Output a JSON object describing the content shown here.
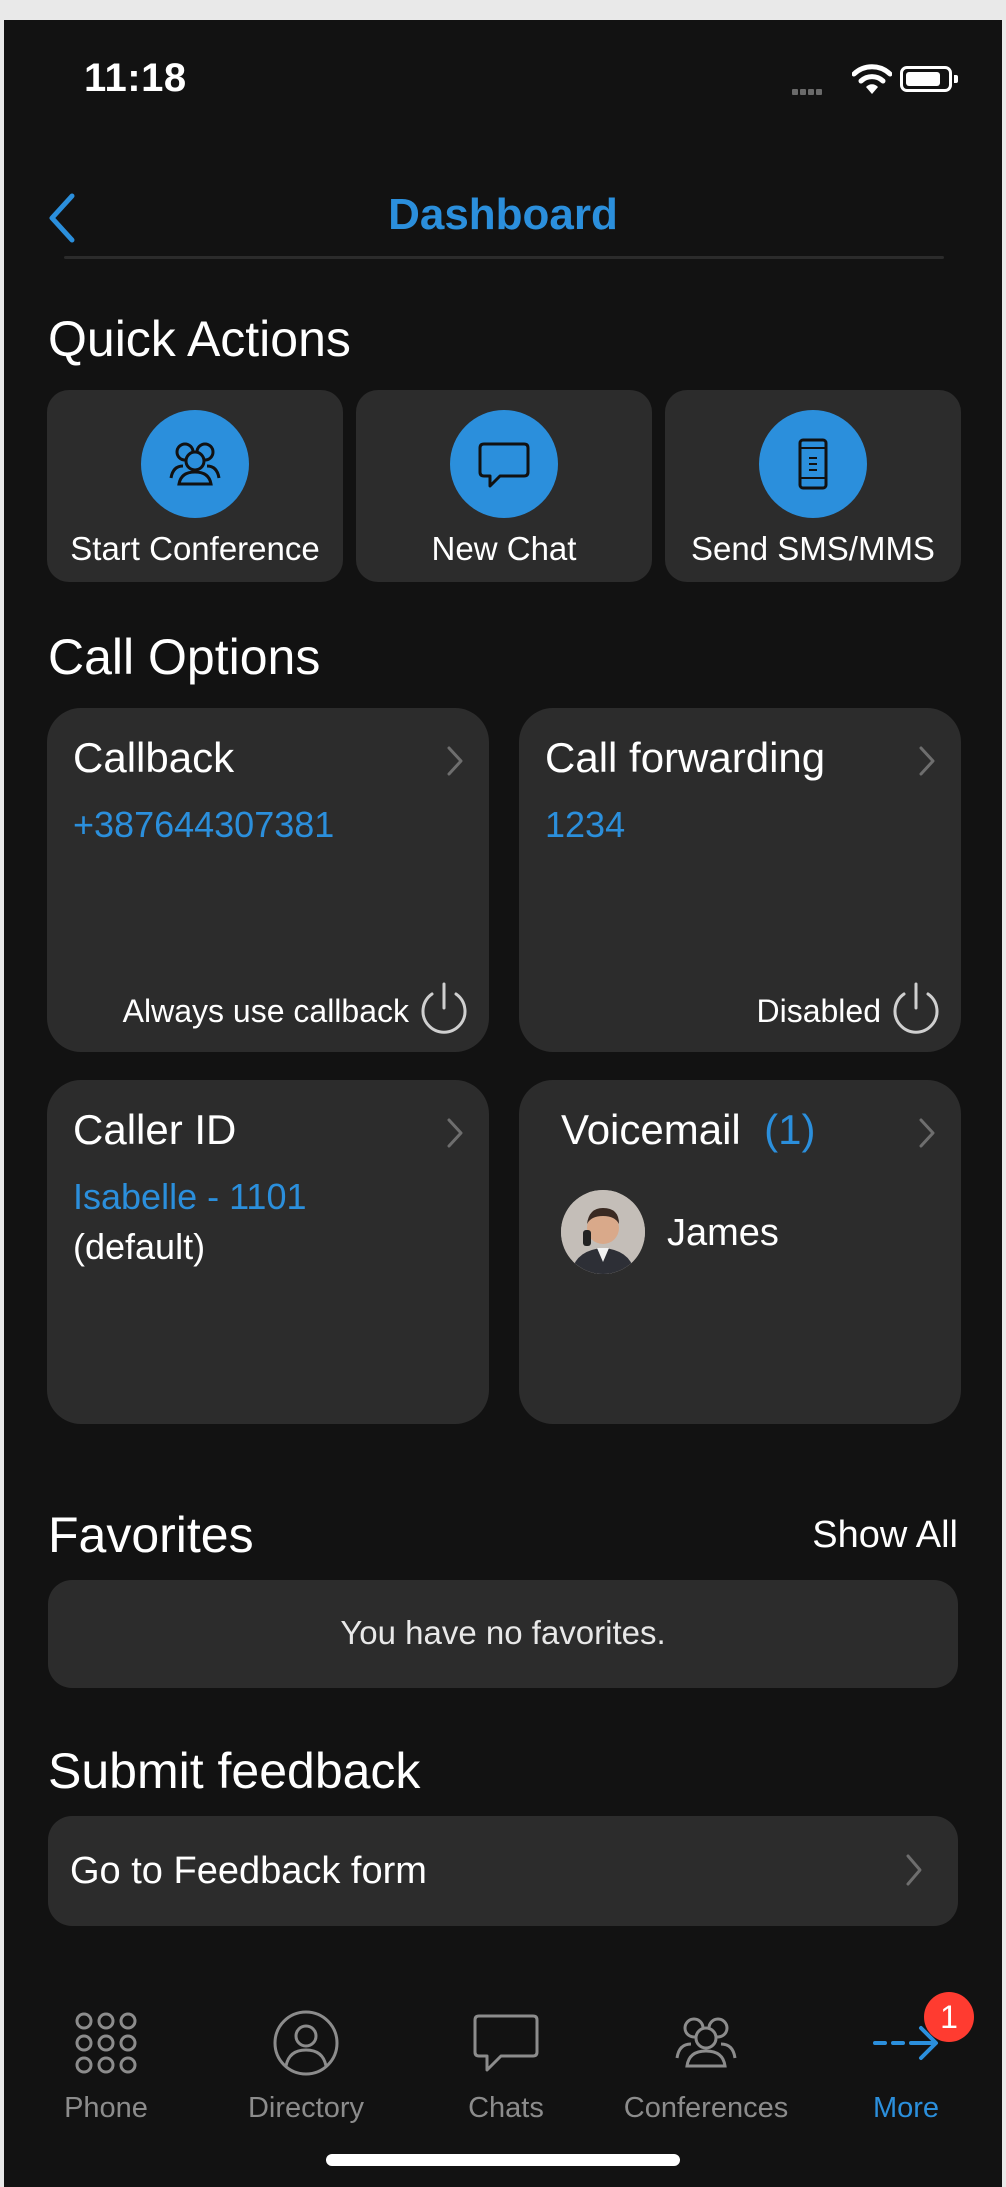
{
  "status_bar": {
    "time": "11:18"
  },
  "header": {
    "title": "Dashboard"
  },
  "quick_actions": {
    "title": "Quick Actions",
    "items": [
      {
        "label": "Start Conference",
        "icon": "conference-icon"
      },
      {
        "label": "New Chat",
        "icon": "chat-bubble-icon"
      },
      {
        "label": "Send SMS/MMS",
        "icon": "mobile-phone-icon"
      }
    ]
  },
  "call_options": {
    "title": "Call Options",
    "callback": {
      "title": "Callback",
      "value": "+387644307381",
      "status": "Always use callback"
    },
    "call_forwarding": {
      "title": "Call forwarding",
      "value": "1234",
      "status": "Disabled"
    },
    "caller_id": {
      "title": "Caller ID",
      "value": "Isabelle - 1101",
      "sub": "(default)"
    },
    "voicemail": {
      "title": "Voicemail",
      "count": "(1)",
      "name": "James"
    }
  },
  "favorites": {
    "title": "Favorites",
    "show_all": "Show All",
    "empty_text": "You have no favorites."
  },
  "feedback": {
    "title": "Submit feedback",
    "link_label": "Go to Feedback form"
  },
  "tab_bar": {
    "items": [
      {
        "label": "Phone",
        "icon": "dialpad-icon"
      },
      {
        "label": "Directory",
        "icon": "person-icon"
      },
      {
        "label": "Chats",
        "icon": "chat-bubble-icon"
      },
      {
        "label": "Conferences",
        "icon": "conference-icon"
      },
      {
        "label": "More",
        "icon": "more-arrow-icon",
        "badge": "1"
      }
    ],
    "active_index": 4
  },
  "colors": {
    "accent": "#2b8fdc",
    "background": "#121212",
    "card": "#2c2c2c",
    "badge": "#ff3b30"
  }
}
